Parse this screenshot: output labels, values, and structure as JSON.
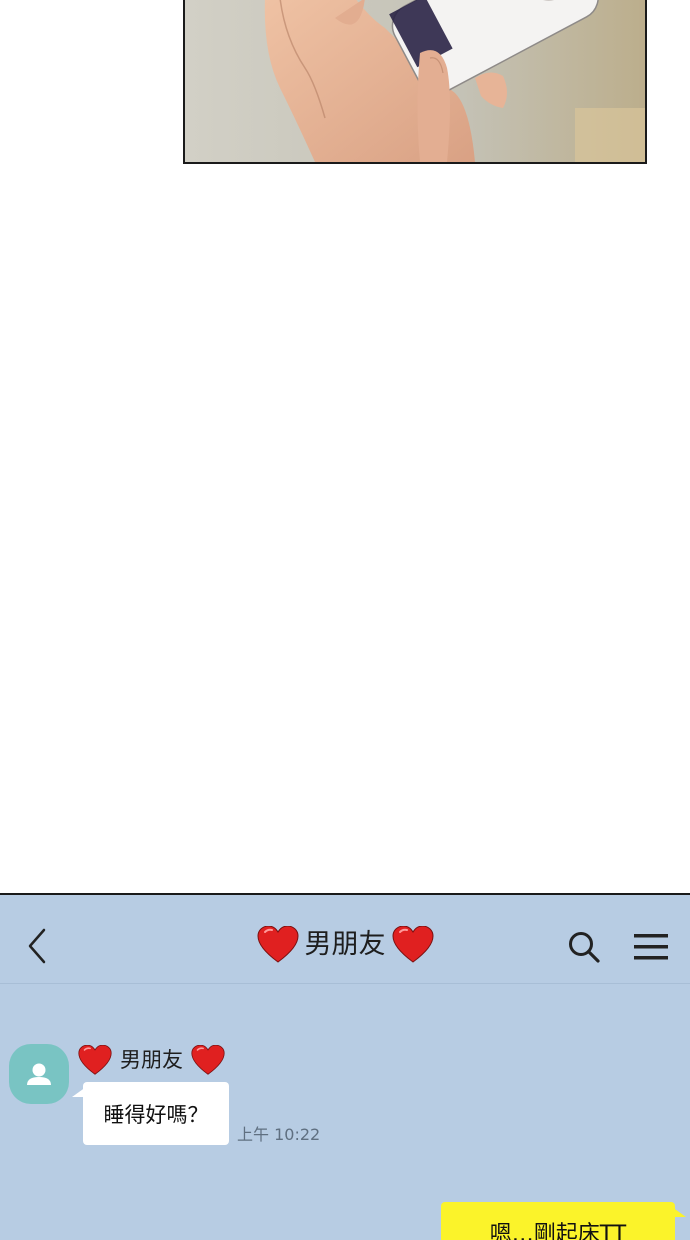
{
  "chat": {
    "title": "男朋友",
    "contact": {
      "name": "男朋友"
    },
    "messages": [
      {
        "direction": "incoming",
        "text": "睡得好嗎？",
        "time": "上午 10:22"
      },
      {
        "direction": "outgoing",
        "text": "嗯…剛起床TT"
      }
    ],
    "icons": {
      "back": "back-chevron-icon",
      "search": "search-icon",
      "menu": "menu-icon",
      "heart": "heart-icon",
      "avatar": "person-icon"
    }
  },
  "colors": {
    "chat_background": "#b7cce3",
    "incoming_bubble": "#ffffff",
    "outgoing_bubble": "#fbf32a",
    "avatar": "#79c4c3",
    "heart": "#e02020"
  }
}
